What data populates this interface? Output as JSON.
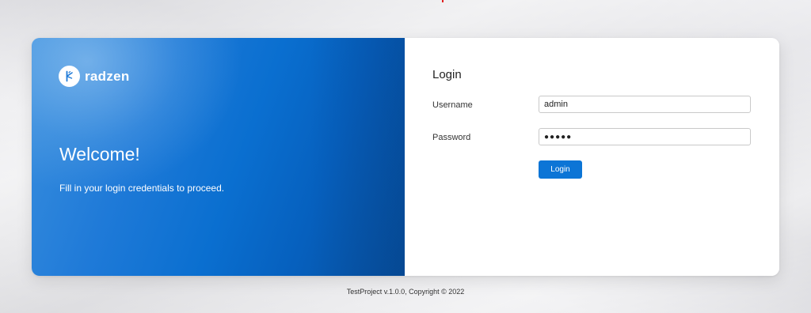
{
  "brand": {
    "name": "radzen",
    "logo_icon": "radzen-logo-icon"
  },
  "hero": {
    "heading": "Welcome!",
    "subtitle": "Fill in your login credentials to proceed."
  },
  "login_form": {
    "title": "Login",
    "username": {
      "label": "Username",
      "value": "admin"
    },
    "password": {
      "label": "Password",
      "value": "●●●●●"
    },
    "submit_label": "Login"
  },
  "footer": {
    "text": "TestProject v.1.0.0, Copyright © 2022"
  },
  "colors": {
    "accent": "#0c75d6",
    "hero_blue": "#0a6fd0"
  }
}
